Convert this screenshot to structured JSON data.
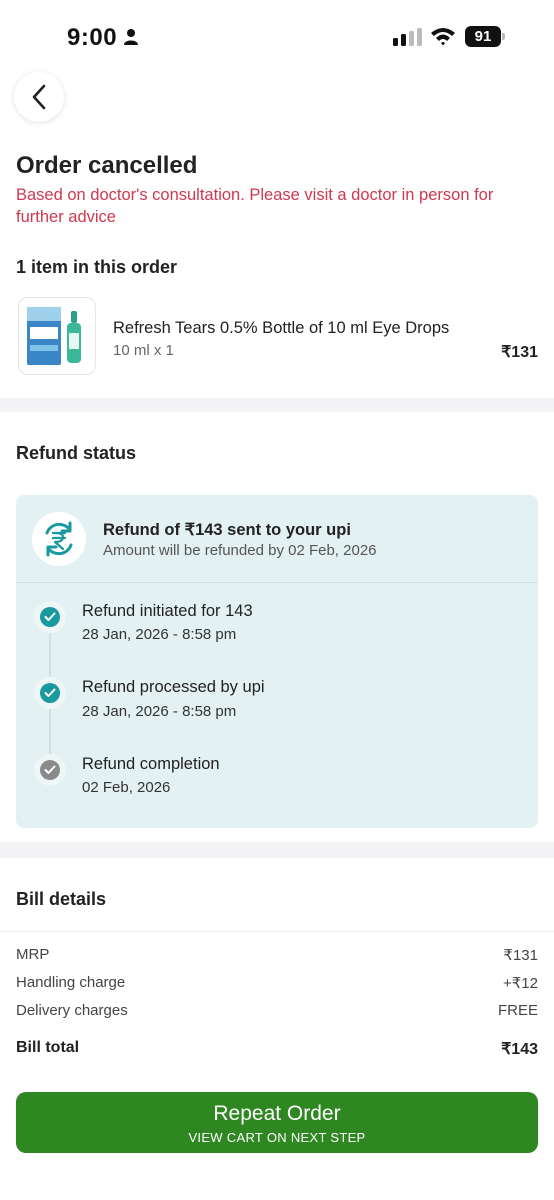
{
  "status_bar": {
    "time": "9:00",
    "battery": "91"
  },
  "order": {
    "title": "Order cancelled",
    "reason": "Based on doctor's consultation. Please visit a doctor in person for further advice",
    "items_heading": "1 item in this order",
    "item": {
      "name": "Refresh Tears 0.5% Bottle of 10 ml Eye Drops",
      "qty": "10 ml x 1",
      "price": "₹131"
    }
  },
  "refund": {
    "heading": "Refund status",
    "title": "Refund of ₹143 sent to your upi",
    "subtitle": "Amount will be refunded by 02 Feb, 2026",
    "steps": [
      {
        "title": "Refund initiated for 143",
        "date": "28 Jan, 2026 - 8:58 pm",
        "status": "done"
      },
      {
        "title": "Refund processed by upi",
        "date": "28 Jan, 2026 - 8:58 pm",
        "status": "done"
      },
      {
        "title": "Refund completion",
        "date": "02 Feb, 2026",
        "status": "pending"
      }
    ]
  },
  "bill": {
    "heading": "Bill details",
    "rows": [
      {
        "label": "MRP",
        "value": "₹131"
      },
      {
        "label": "Handling charge",
        "value": "+₹12"
      },
      {
        "label": "Delivery charges",
        "value": "FREE"
      }
    ],
    "total": {
      "label": "Bill total",
      "value": "₹143"
    }
  },
  "cta": {
    "label": "Repeat Order",
    "sublabel": "VIEW CART ON NEXT STEP"
  },
  "colors": {
    "accent_green": "#2e8720",
    "teal": "#1a9aa0",
    "alert_red": "#d0384e",
    "card_bg": "#e3f1f2"
  }
}
